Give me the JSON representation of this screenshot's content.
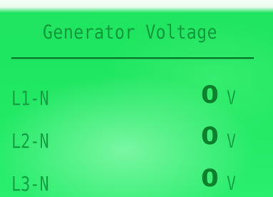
{
  "display": {
    "title": "Generator Voltage",
    "readings": [
      {
        "label": "L1-N",
        "value": "0",
        "unit": "V"
      },
      {
        "label": "L2-N",
        "value": "0",
        "unit": "V"
      },
      {
        "label": "L3-N",
        "value": "0",
        "unit": "V"
      }
    ]
  },
  "colors": {
    "screen_background": "#1fe761",
    "text": "#0f8a32"
  }
}
